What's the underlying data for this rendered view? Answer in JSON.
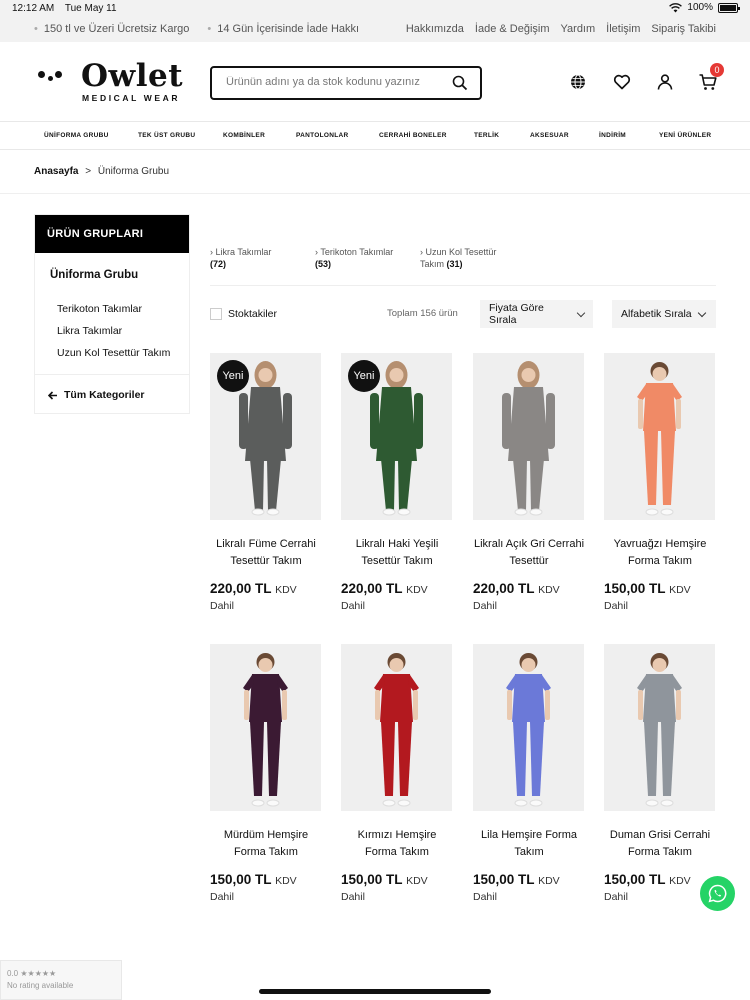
{
  "status_bar": {
    "time": "12:12 AM",
    "date": "Tue May 11",
    "battery": "100%"
  },
  "topbar": {
    "promos": [
      "150 tl ve Üzeri Ücretsiz Kargo",
      "14 Gün İçerisinde İade Hakkı"
    ],
    "links": [
      "Hakkımızda",
      "İade & Değişim",
      "Yardım",
      "İletişim",
      "Sipariş Takibi"
    ]
  },
  "header": {
    "logo_word": "Owlet",
    "logo_sub": "MEDICAL WEAR",
    "search_placeholder": "Ürünün adını ya da stok kodunu yazınız",
    "cart_count": "0",
    "icons": [
      "globe-icon",
      "heart-icon",
      "user-icon",
      "cart-icon"
    ]
  },
  "nav": [
    "ÜNİFORMA GRUBU",
    "TEK ÜST GRUBU",
    "KOMBİNLER",
    "PANTOLONLAR",
    "CERRAHİ BONELER",
    "TERLİK",
    "AKSESUAR",
    "İNDİRİM",
    "YENİ ÜRÜNLER"
  ],
  "breadcrumb": {
    "home": "Anasayfa",
    "sep": ">",
    "current": "Üniforma Grubu"
  },
  "sidebar": {
    "title": "ÜRÜN GRUPLARI",
    "group": "Üniforma Grubu",
    "items": [
      "Terikoton Takımlar",
      "Likra Takımlar",
      "Uzun Kol Tesettür Takım"
    ],
    "all_label": "Tüm Kategoriler"
  },
  "subcategories": [
    {
      "name": "Likra Takımlar",
      "count": "(72)"
    },
    {
      "name": "Terikoton Takımlar",
      "count": "(53)"
    },
    {
      "name": "Uzun Kol Tesettür Takım",
      "count": "(31)"
    }
  ],
  "toolbar": {
    "stock_label": "Stoktakiler",
    "total": "Toplam 156 ürün",
    "sort_price": "Fiyata Göre Sırala",
    "sort_alpha": "Alfabetik Sırala"
  },
  "products": [
    {
      "title": "Likralı Füme Cerrahi Tesettür Takım",
      "price": "220,00 TL",
      "badge": "Yeni",
      "color": "#5b5d5c",
      "hijab": true
    },
    {
      "title": "Likralı Haki Yeşili Tesettür Takım",
      "price": "220,00 TL",
      "badge": "Yeni",
      "color": "#2e5a32",
      "hijab": true
    },
    {
      "title": "Likralı Açık Gri Cerrahi Tesettür",
      "price": "220,00 TL",
      "badge": "",
      "color": "#8a8785",
      "hijab": true
    },
    {
      "title": "Yavruağzı Hemşire Forma Takım",
      "price": "150,00 TL",
      "badge": "",
      "color": "#f08a66",
      "hijab": false
    },
    {
      "title": "Mürdüm Hemşire Forma Takım",
      "price": "150,00 TL",
      "badge": "",
      "color": "#3b1a33",
      "hijab": false
    },
    {
      "title": "Kırmızı Hemşire Forma Takım",
      "price": "150,00 TL",
      "badge": "",
      "color": "#b3191f",
      "hijab": false
    },
    {
      "title": "Lila Hemşire Forma Takım",
      "price": "150,00 TL",
      "badge": "",
      "color": "#6b79d8",
      "hijab": false
    },
    {
      "title": "Duman Grisi Cerrahi Forma Takım",
      "price": "150,00 TL",
      "badge": "",
      "color": "#8f959c",
      "hijab": false
    }
  ],
  "price_suffix": "KDV",
  "price_note": "Dahil",
  "rating_widget": {
    "score": "0.0 ★★★★★",
    "text": "No rating available"
  }
}
